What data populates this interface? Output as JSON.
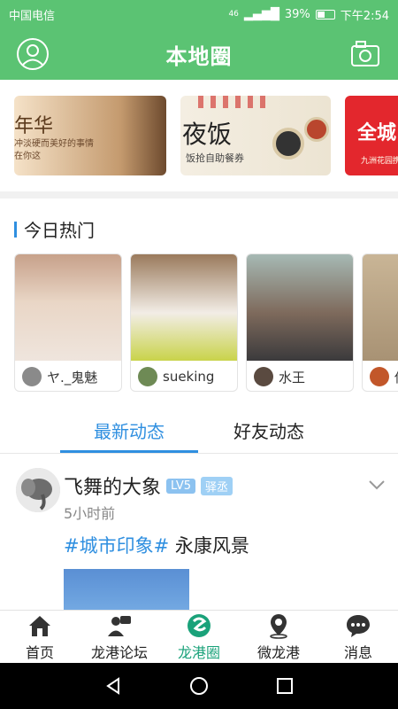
{
  "status": {
    "carrier": "中国电信",
    "signal": "46",
    "battery": "39%",
    "time": "下午2:54"
  },
  "header": {
    "title": "本地圈"
  },
  "banners": [
    {
      "text": "年华",
      "sub": "冲淡硬而美好的事情 在你这"
    },
    {
      "text": "夜饭",
      "sub": "饭抢自助餐券"
    },
    {
      "text": "全城",
      "sub": "九洲花园携手"
    }
  ],
  "hot": {
    "title": "今日热门",
    "items": [
      {
        "user": "ヤ._鬼魅"
      },
      {
        "user": "sueking"
      },
      {
        "user": "水王"
      },
      {
        "user": "你"
      }
    ]
  },
  "tabs": {
    "latest": "最新动态",
    "friends": "好友动态"
  },
  "post": {
    "name": "飞舞的大象",
    "level": "LV5",
    "role": "驿丞",
    "time": "5小时前",
    "topic": "#城市印象#",
    "text": " 永康风景"
  },
  "nav": [
    {
      "label": "首页"
    },
    {
      "label": "龙港论坛"
    },
    {
      "label": "龙港圈"
    },
    {
      "label": "微龙港"
    },
    {
      "label": "消息"
    }
  ],
  "colors": {
    "primary": "#5bc373",
    "accent": "#2f8fe0",
    "activeNav": "#1aa27a"
  }
}
